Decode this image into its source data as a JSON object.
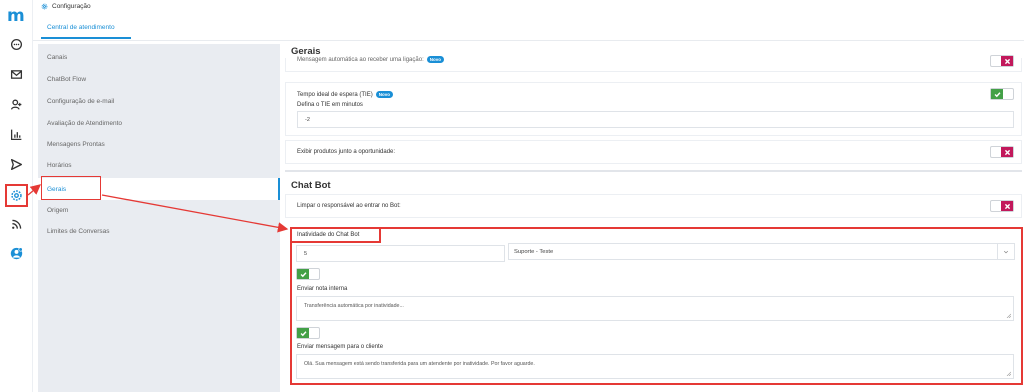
{
  "app": {
    "logo": "m"
  },
  "header": {
    "title": "Configuração",
    "tab": "Central de atendimento"
  },
  "menu": {
    "items": [
      {
        "label": "Canais"
      },
      {
        "label": "ChatBot Flow"
      },
      {
        "label": "Configuração de e-mail"
      },
      {
        "label": "Avaliação de Atendimento"
      },
      {
        "label": "Mensagens Prontas"
      },
      {
        "label": "Horários"
      },
      {
        "label": "Gerais"
      },
      {
        "label": "Origem"
      },
      {
        "label": "Limites de Conversas"
      }
    ],
    "active_index": 6
  },
  "gerais": {
    "title": "Gerais",
    "auto_msg_label": "Mensagem automática ao receber uma ligação:",
    "tie_label": "Tempo ideal de espera (TIE)",
    "new_badge": "Novo",
    "tie_sub_label": "Defina o TIE em minutos",
    "tie_value": "-2",
    "products_label": "Exibir produtos junto a oportunidade:"
  },
  "chatbot": {
    "title": "Chat Bot",
    "clear_label": "Limpar o responsável ao entrar no Bot:",
    "inactivity_label": "Inatividade do Chat Bot",
    "inactivity_value": "5",
    "select_value": "Suporte - Teste",
    "internal_note_label": "Enviar nota interna",
    "internal_note_text": "Transferência automática por inatividade...",
    "client_msg_label": "Enviar mensagem para o cliente",
    "client_msg_text": "Olá. Sua mensagem está sendo transferida para um atendente por inatividade. Por favor aguarde."
  },
  "toggles": {
    "auto_msg": "off",
    "tie": "on",
    "products": "off",
    "clear_bot": "off",
    "internal_note": "on",
    "client_msg": "on"
  },
  "colors": {
    "accent": "#1a8fd6",
    "on": "#43a047",
    "off": "#c2185b",
    "annotation": "#e53935",
    "menu_bg": "#e9ecf1"
  }
}
